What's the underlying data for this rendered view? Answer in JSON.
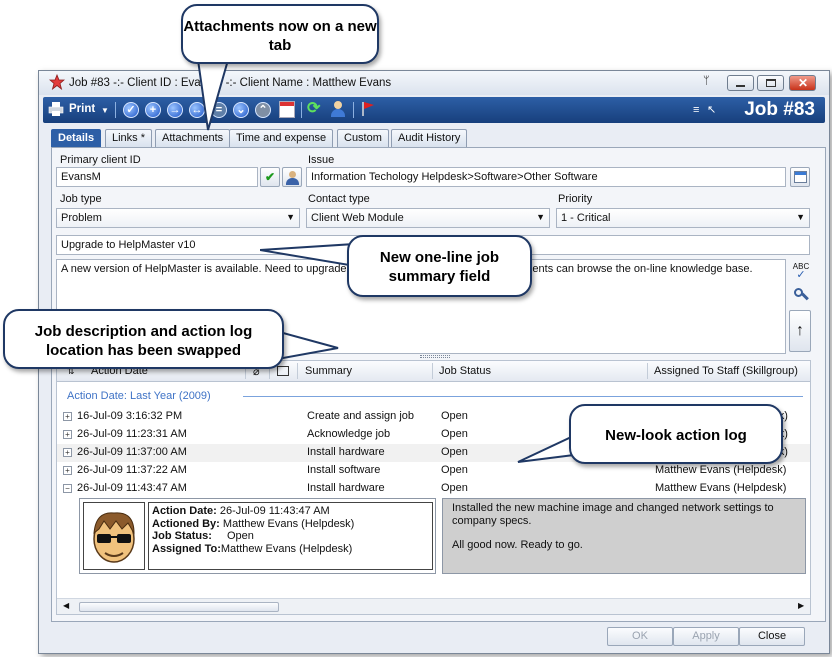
{
  "window": {
    "title": "Job #83  -:-  Client ID : EvansM  -:-  Client Name : Matthew Evans",
    "heading": "Job #83"
  },
  "toolbar": {
    "print_label": "Print"
  },
  "tabs": [
    {
      "label": "Details",
      "active": true
    },
    {
      "label": "Links *",
      "active": false
    },
    {
      "label": "Attachments",
      "active": false
    },
    {
      "label": "Time and expense",
      "active": false
    },
    {
      "label": "Custom",
      "active": false
    },
    {
      "label": "Audit History",
      "active": false
    }
  ],
  "form": {
    "primary_client_label": "Primary client ID",
    "primary_client_value": "EvansM",
    "issue_label": "Issue",
    "issue_value": "Information Techology Helpdesk>Software>Other Software",
    "job_type_label": "Job type",
    "job_type_value": "Problem",
    "contact_type_label": "Contact type",
    "contact_type_value": "Client Web Module",
    "priority_label": "Priority",
    "priority_value": "1 - Critical",
    "summary_value": "Upgrade to HelpMaster v10",
    "description_value": "A new version of HelpMaster is available.  Need to upgrade e... install the web interface so that clients can browse the on-line knowledge base."
  },
  "grid": {
    "columns": [
      "Action Date",
      "Summary",
      "Job Status",
      "Assigned To Staff (Skillgroup)"
    ],
    "group_label": "Action Date:   Last Year     (2009)",
    "rows": [
      {
        "date": "16-Jul-09 3:16:32 PM",
        "summary": "Create and assign job",
        "status": "Open",
        "assigned": "desk)",
        "expanded": false
      },
      {
        "date": "26-Jul-09 11:23:31 AM",
        "summary": "Acknowledge job",
        "status": "Open",
        "assigned": "desk)",
        "expanded": false
      },
      {
        "date": "26-Jul-09 11:37:00 AM",
        "summary": "Install hardware",
        "status": "Open",
        "assigned": "desk)",
        "expanded": false
      },
      {
        "date": "26-Jul-09 11:37:22 AM",
        "summary": "Install software",
        "status": "Open",
        "assigned": "Matthew Evans (Helpdesk)",
        "expanded": false
      },
      {
        "date": "26-Jul-09 11:43:47 AM",
        "summary": "Install hardware",
        "status": "Open",
        "assigned": "Matthew Evans (Helpdesk)",
        "expanded": true
      }
    ],
    "detail": {
      "action_date_label": "Action Date:",
      "action_date_value": "26-Jul-09 11:43:47 AM",
      "actioned_by_label": "Actioned By:",
      "actioned_by_value": "Matthew Evans (Helpdesk)",
      "job_status_label": "Job Status:",
      "job_status_value": "Open",
      "assigned_to_label": "Assigned To:",
      "assigned_to_value": "Matthew Evans (Helpdesk)",
      "note_line1": "Installed the new machine image and changed network settings to company specs.",
      "note_line2": "All good now.  Ready to go."
    }
  },
  "footer": {
    "ok": "OK",
    "apply": "Apply",
    "close": "Close"
  },
  "callouts": {
    "attachments": "Attachments now on a new tab",
    "summary": "New one-line job summary field",
    "swap": "Job description and action log location has been swapped",
    "action_log": "New-look action log"
  }
}
